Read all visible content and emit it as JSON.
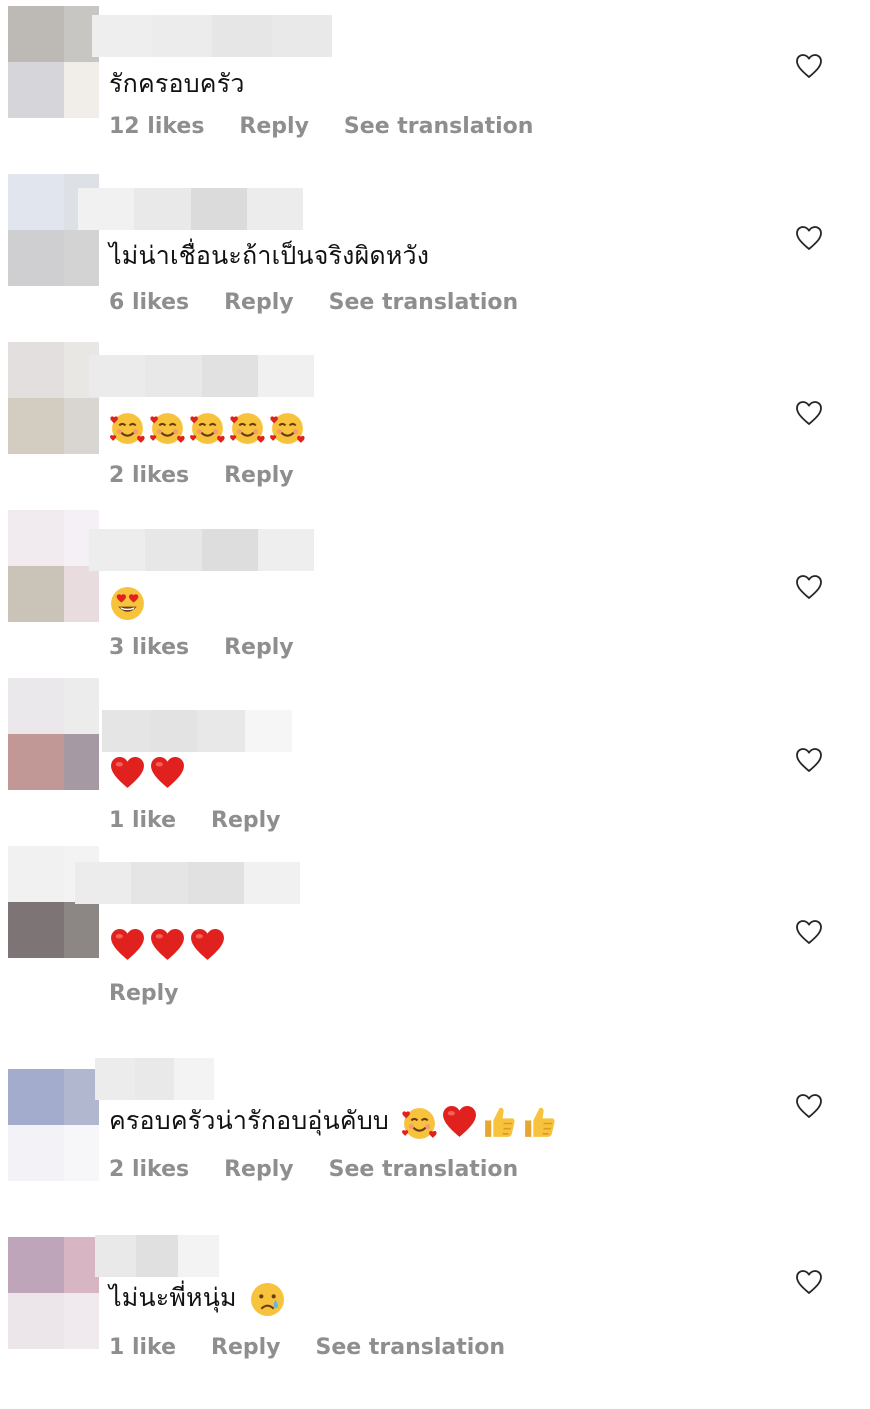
{
  "comments": [
    {
      "text": "รักครอบครัว",
      "likes": "12 likes",
      "reply": "Reply",
      "translate": "See translation",
      "avatar_colors": [
        "#bdbab6",
        "#c8c6c3",
        "#d6d5d9",
        "#f1eee9"
      ]
    },
    {
      "text": "ไม่น่าเชื่อนะถ้าเป็นจริงผิดหวัง",
      "likes": "6 likes",
      "reply": "Reply",
      "translate": "See translation",
      "avatar_colors": [
        "#e1e6ee",
        "#dde0e4",
        "#cfcfd1",
        "#d3d3d3"
      ]
    },
    {
      "text": "",
      "emojis": [
        "smiling-hearts",
        "smiling-hearts",
        "smiling-hearts",
        "smiling-hearts",
        "smiling-hearts"
      ],
      "likes": "2 likes",
      "reply": "Reply",
      "translate": "",
      "avatar_colors": [
        "#e2dfde",
        "#e9e7e4",
        "#d3cdc1",
        "#d9d6d2"
      ]
    },
    {
      "text": "",
      "emojis": [
        "heart-eyes"
      ],
      "likes": "3 likes",
      "reply": "Reply",
      "translate": "",
      "avatar_colors": [
        "#f1ebf0",
        "#f5f0f5",
        "#cac4b8",
        "#e8dcdf"
      ]
    },
    {
      "text": "",
      "emojis": [
        "red-heart",
        "red-heart"
      ],
      "likes": "1 like",
      "reply": "Reply",
      "translate": "",
      "avatar_colors": [
        "#eae8ea",
        "#ececec",
        "#c29897",
        "#a59aa3"
      ]
    },
    {
      "text": "",
      "emojis": [
        "red-heart",
        "red-heart",
        "red-heart"
      ],
      "likes": "",
      "reply": "Reply",
      "translate": "",
      "avatar_colors": [
        "#f1f1f1",
        "#f3f3f3",
        "#7d7575",
        "#8c8784"
      ]
    },
    {
      "text": "ครอบครัวน่ารักอบอุ่นคับบ",
      "emojis": [
        "smiling-hearts",
        "red-heart",
        "thumbs-up",
        "thumbs-up"
      ],
      "likes": "2 likes",
      "reply": "Reply",
      "translate": "See translation",
      "avatar_colors": [
        "#a4acce",
        "#b2b7d0",
        "#f3f3f7",
        "#f7f7f9"
      ]
    },
    {
      "text": "ไม่นะพี่หนุ่ม",
      "emojis": [
        "crying-face"
      ],
      "likes": "1 like",
      "reply": "Reply",
      "translate": "See translation",
      "avatar_colors": [
        "#bfa5b9",
        "#d8b5c3",
        "#ece6ea",
        "#f0eaee"
      ]
    }
  ],
  "colors": {
    "text": "#111111",
    "meta": "#8e8e8e",
    "heart_outline": "#262626",
    "emoji_red": "#e0211d",
    "emoji_yellow": "#f7c23c"
  }
}
